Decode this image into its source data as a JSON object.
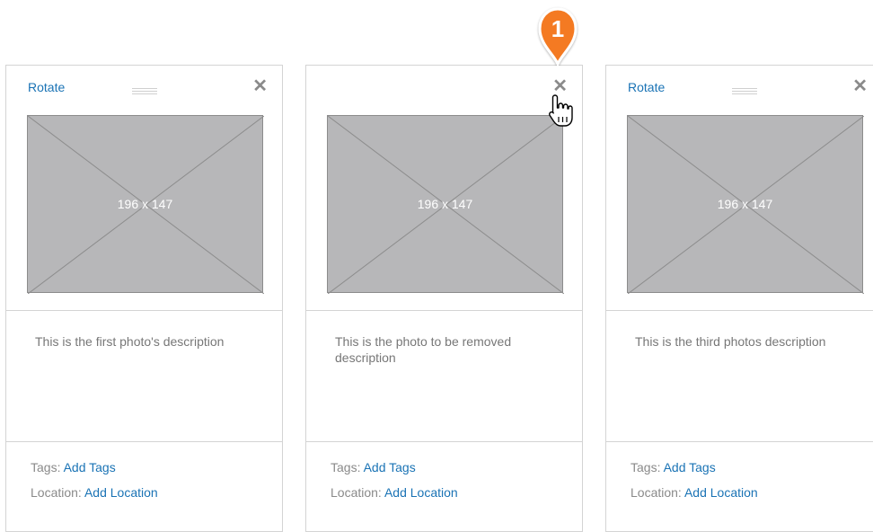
{
  "cards": [
    {
      "rotate_label": "Rotate",
      "image_size_label": "196 x 147",
      "description": "This is the first photo's description",
      "tags_label": "Tags:",
      "tags_link": "Add Tags",
      "location_label": "Location:",
      "location_link": "Add Location"
    },
    {
      "image_size_label": "196 x 147",
      "description": "This is the photo to be removed description",
      "tags_label": "Tags:",
      "tags_link": "Add Tags",
      "location_label": "Location:",
      "location_link": "Add Location"
    },
    {
      "rotate_label": "Rotate",
      "image_size_label": "196 x 147",
      "description": "This is the third photos description",
      "tags_label": "Tags:",
      "tags_link": "Add Tags",
      "location_label": "Location:",
      "location_link": "Add Location"
    }
  ],
  "close_glyph": "✕",
  "annotation_marker": "1",
  "colors": {
    "link": "#1a73b5",
    "marker": "#f47a20",
    "placeholder": "#b7b7b9"
  }
}
